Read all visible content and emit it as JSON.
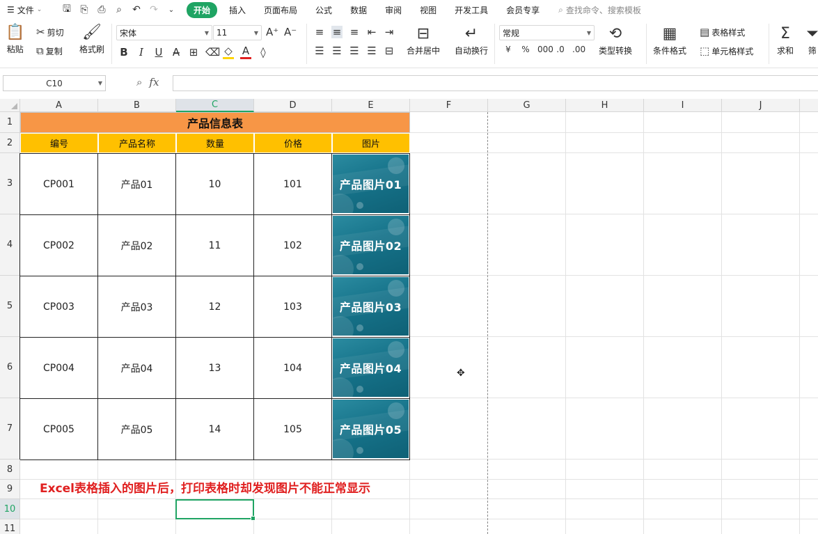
{
  "menu": {
    "file_label": "文件",
    "tabs": [
      "开始",
      "插入",
      "页面布局",
      "公式",
      "数据",
      "审阅",
      "视图",
      "开发工具",
      "会员专享"
    ],
    "search_placeholder": "查找命令、搜索模板"
  },
  "ribbon": {
    "paste": "粘贴",
    "cut": "剪切",
    "copy": "复制",
    "format_painter": "格式刷",
    "font_name": "宋体",
    "font_size": "11",
    "merge_center": "合并居中",
    "wrap_text": "自动换行",
    "number_format": "常规",
    "type_convert": "类型转换",
    "conditional_format": "条件格式",
    "table_style": "表格样式",
    "cell_style": "单元格样式",
    "sum": "求和",
    "filter": "筛"
  },
  "formula_bar": {
    "name_box": "C10",
    "fx": "fx",
    "value": ""
  },
  "columns": [
    "A",
    "B",
    "C",
    "D",
    "E",
    "F",
    "G",
    "H",
    "I",
    "J"
  ],
  "selected_column": "C",
  "rows": [
    "1",
    "2",
    "3",
    "4",
    "5",
    "6",
    "7",
    "8",
    "9",
    "10",
    "11"
  ],
  "selected_row": "10",
  "sheet": {
    "title": "产品信息表",
    "headers": [
      "编号",
      "产品名称",
      "数量",
      "价格",
      "图片"
    ],
    "records": [
      {
        "id": "CP001",
        "name": "产品01",
        "qty": "10",
        "price": "101",
        "image": "产品图片01"
      },
      {
        "id": "CP002",
        "name": "产品02",
        "qty": "11",
        "price": "102",
        "image": "产品图片02"
      },
      {
        "id": "CP003",
        "name": "产品03",
        "qty": "12",
        "price": "103",
        "image": "产品图片03"
      },
      {
        "id": "CP004",
        "name": "产品04",
        "qty": "13",
        "price": "104",
        "image": "产品图片04"
      },
      {
        "id": "CP005",
        "name": "产品05",
        "qty": "14",
        "price": "105",
        "image": "产品图片05"
      }
    ],
    "note": "Excel表格插入的图片后，打印表格时却发现图片不能正常显示"
  },
  "colors": {
    "accent": "#1fa463",
    "title_fill": "#f79646",
    "header_fill": "#ffc000",
    "note_text": "#e02020",
    "picture_fill": "#16738a"
  }
}
